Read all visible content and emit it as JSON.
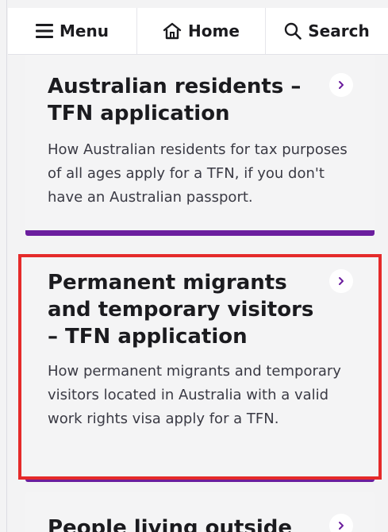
{
  "nav": {
    "menu_label": "Menu",
    "home_label": "Home",
    "search_label": "Search"
  },
  "cards": [
    {
      "title": "Australian residents – TFN application",
      "description": "How Australian residents for tax purposes of all ages apply for a TFN, if you don't have an Australian passport."
    },
    {
      "title": "Permanent migrants and temporary visitors – TFN application",
      "description": "How permanent migrants and temporary visitors located in Australia with a valid work rights visa apply for a TFN."
    },
    {
      "title": "People living outside",
      "description": ""
    }
  ],
  "colors": {
    "accent": "#6b1e9e",
    "highlight": "#e52a2a",
    "card_bg": "#f4f4f5"
  },
  "icons": {
    "menu": "hamburger-icon",
    "home": "home-icon",
    "search": "search-icon",
    "card_link": "chevron-right-icon"
  }
}
